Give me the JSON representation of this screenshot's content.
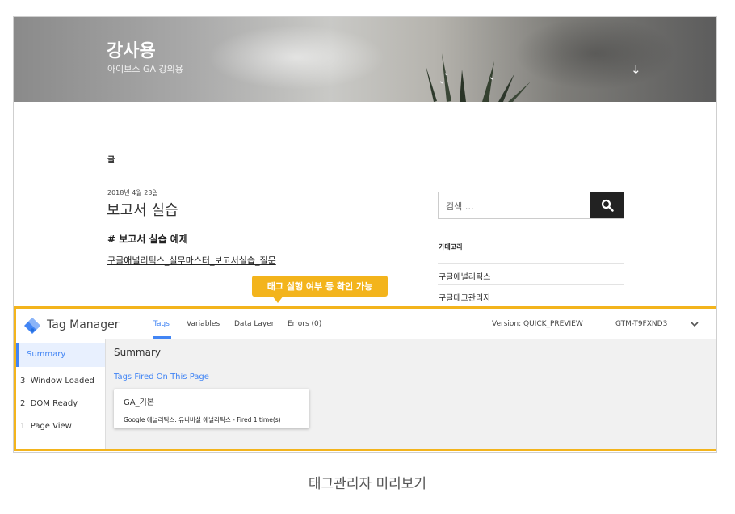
{
  "blog": {
    "site_title": "강사용",
    "site_description": "아이보스 GA 강의용",
    "posts_label": "글",
    "post_date": "2018년 4월 23일",
    "post_title": "보고서 실습",
    "post_subheading": "# 보고서 실습 예제",
    "post_link": "구글애널리틱스_실무마스터_보고서실습_질문",
    "search_placeholder": "검색 …",
    "categories_heading": "카테고리",
    "categories": [
      "구글애널리틱스",
      "구글태그관리자"
    ]
  },
  "callout": {
    "text": "태그 실행 여부 등 확인 가능",
    "color": "#f3b41c"
  },
  "gtm": {
    "brand": "Tag Manager",
    "tabs": [
      "Tags",
      "Variables",
      "Data Layer",
      "Errors (0)"
    ],
    "active_tab": "Tags",
    "version": "Version: QUICK_PREVIEW",
    "container_id": "GTM-T9FXND3",
    "sidebar": {
      "active": "Summary",
      "events": [
        {
          "num": "3",
          "label": "Window Loaded"
        },
        {
          "num": "2",
          "label": "DOM Ready"
        },
        {
          "num": "1",
          "label": "Page View"
        }
      ]
    },
    "main_title": "Summary",
    "fired_label": "Tags Fired On This Page",
    "tag": {
      "name": "GA_기본",
      "description": "Google 애널리틱스: 유니버설 애널리틱스 - Fired 1 time(s)"
    },
    "accent_color": "#4285f4"
  },
  "caption": "태그관리자 미리보기"
}
